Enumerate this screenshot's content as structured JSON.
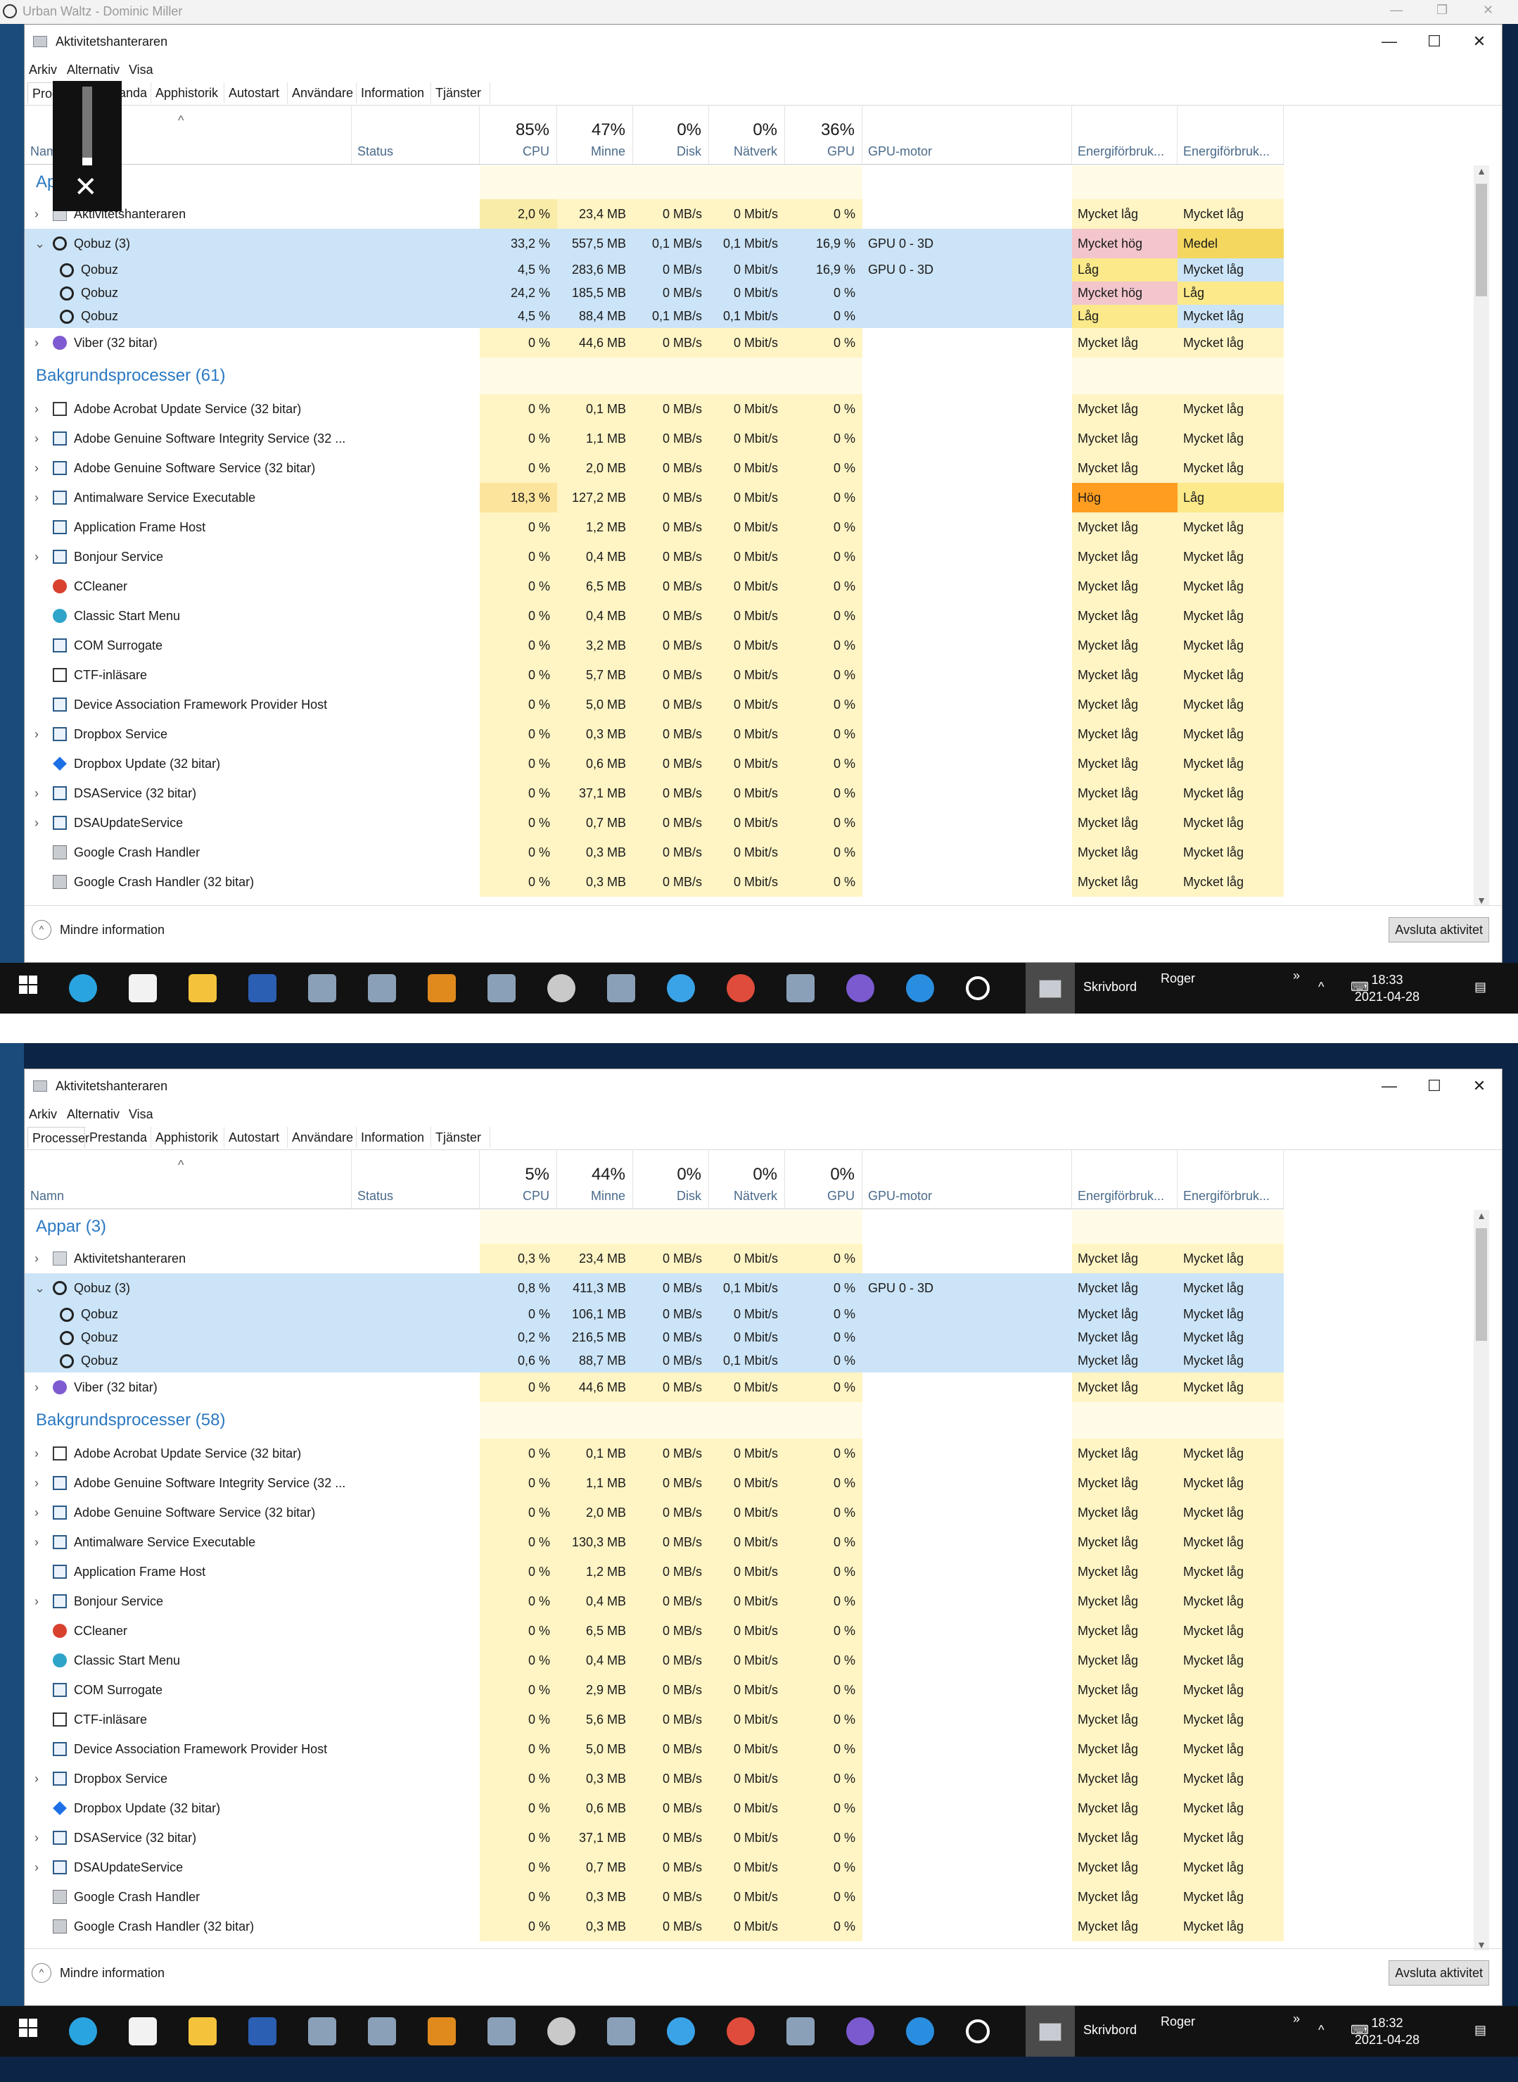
{
  "background_window": {
    "title": "Urban Waltz - Dominic Miller"
  },
  "taskbar": {
    "desktop_label": "Skrivbord",
    "user_label": "Roger",
    "overflow_label": "»",
    "caret_label": "^",
    "icons": [
      "windows-icon",
      "edge-icon",
      "store-icon",
      "explorer-icon",
      "word-icon",
      "app-icon",
      "app-icon",
      "outlook-icon",
      "app-icon",
      "esi-icon",
      "app-icon",
      "itunes-icon",
      "chrome-icon",
      "app-icon",
      "viber-icon",
      "ie-icon",
      "qobuz-icon",
      "taskmanager-icon"
    ]
  },
  "shots": [
    {
      "window_title": "Aktivitetshanteraren",
      "menu": [
        "Arkiv",
        "Alternativ",
        "Visa"
      ],
      "tabs": [
        "Processer",
        "Prestanda",
        "Apphistorik",
        "Autostart",
        "Användare",
        "Information",
        "Tjänster"
      ],
      "header": {
        "name": "Namn",
        "status": "Status",
        "cpu_pct": "85%",
        "cpu": "CPU",
        "mem_pct": "47%",
        "mem": "Minne",
        "disk_pct": "0%",
        "disk": "Disk",
        "net_pct": "0%",
        "net": "Nätverk",
        "gpu_pct": "36%",
        "gpu": "GPU",
        "gpu_engine": "GPU-motor",
        "energy": "Energiförbruk...",
        "energy_trend": "Energiförbruk..."
      },
      "groups": {
        "apps": "Appar (3)",
        "background": "Bakgrundsprocesser (61)"
      },
      "apps": [
        {
          "name": "Aktivitetshanteraren",
          "icon": "gear-icon",
          "chev": ">",
          "cpu": "2,0 %",
          "mem": "23,4 MB",
          "disk": "0 MB/s",
          "net": "0 Mbit/s",
          "gpu": "0 %",
          "engine": "",
          "energy": "Mycket låg",
          "trend": "Mycket låg"
        },
        {
          "name": "Qobuz (3)",
          "icon": "qobuz-icon",
          "chev": "v",
          "selected": true,
          "cpu": "33,2 %",
          "mem": "557,5 MB",
          "disk": "0,1 MB/s",
          "net": "0,1 Mbit/s",
          "gpu": "16,9 %",
          "engine": "GPU 0 - 3D",
          "energy": "Mycket hög",
          "trend": "Medel"
        },
        {
          "name": "Qobuz",
          "icon": "qobuz-icon",
          "child": true,
          "selected": true,
          "cpu": "4,5 %",
          "mem": "283,6 MB",
          "disk": "0 MB/s",
          "net": "0 Mbit/s",
          "gpu": "16,9 %",
          "engine": "GPU 0 - 3D",
          "energy": "Låg",
          "trend": "Mycket låg"
        },
        {
          "name": "Qobuz",
          "icon": "qobuz-icon",
          "child": true,
          "selected": true,
          "cpu": "24,2 %",
          "mem": "185,5 MB",
          "disk": "0 MB/s",
          "net": "0 Mbit/s",
          "gpu": "0 %",
          "engine": "",
          "energy": "Mycket hög",
          "trend": "Låg"
        },
        {
          "name": "Qobuz",
          "icon": "qobuz-icon",
          "child": true,
          "selected": true,
          "cpu": "4,5 %",
          "mem": "88,4 MB",
          "disk": "0,1 MB/s",
          "net": "0,1 Mbit/s",
          "gpu": "0 %",
          "engine": "",
          "energy": "Låg",
          "trend": "Mycket låg"
        },
        {
          "name": "Viber (32 bitar)",
          "icon": "viber-icon",
          "chev": ">",
          "cpu": "0 %",
          "mem": "44,6 MB",
          "disk": "0 MB/s",
          "net": "0 Mbit/s",
          "gpu": "0 %",
          "engine": "",
          "energy": "Mycket låg",
          "trend": "Mycket låg"
        }
      ],
      "background": [
        {
          "name": "Adobe Acrobat Update Service (32 bitar)",
          "icon": "acrobat-icon",
          "chev": ">",
          "cpu": "0 %",
          "mem": "0,1 MB",
          "disk": "0 MB/s",
          "net": "0 Mbit/s",
          "gpu": "0 %",
          "energy": "Mycket låg",
          "trend": "Mycket låg"
        },
        {
          "name": "Adobe Genuine Software Integrity Service (32 ...",
          "icon": "window-icon",
          "chev": ">",
          "cpu": "0 %",
          "mem": "1,1 MB",
          "disk": "0 MB/s",
          "net": "0 Mbit/s",
          "gpu": "0 %",
          "energy": "Mycket låg",
          "trend": "Mycket låg"
        },
        {
          "name": "Adobe Genuine Software Service (32 bitar)",
          "icon": "window-icon",
          "chev": ">",
          "cpu": "0 %",
          "mem": "2,0 MB",
          "disk": "0 MB/s",
          "net": "0 Mbit/s",
          "gpu": "0 %",
          "energy": "Mycket låg",
          "trend": "Mycket låg"
        },
        {
          "name": "Antimalware Service Executable",
          "icon": "window-icon",
          "chev": ">",
          "cpu": "18,3 %",
          "mem": "127,2 MB",
          "disk": "0 MB/s",
          "net": "0 Mbit/s",
          "gpu": "0 %",
          "energy": "Hög",
          "trend": "Låg"
        },
        {
          "name": "Application Frame Host",
          "icon": "window-icon",
          "cpu": "0 %",
          "mem": "1,2 MB",
          "disk": "0 MB/s",
          "net": "0 Mbit/s",
          "gpu": "0 %",
          "energy": "Mycket låg",
          "trend": "Mycket låg"
        },
        {
          "name": "Bonjour Service",
          "icon": "window-icon",
          "chev": ">",
          "cpu": "0 %",
          "mem": "0,4 MB",
          "disk": "0 MB/s",
          "net": "0 Mbit/s",
          "gpu": "0 %",
          "energy": "Mycket låg",
          "trend": "Mycket låg"
        },
        {
          "name": "CCleaner",
          "icon": "ccleaner-icon",
          "cpu": "0 %",
          "mem": "6,5 MB",
          "disk": "0 MB/s",
          "net": "0 Mbit/s",
          "gpu": "0 %",
          "energy": "Mycket låg",
          "trend": "Mycket låg"
        },
        {
          "name": "Classic Start Menu",
          "icon": "classic-start-icon",
          "cpu": "0 %",
          "mem": "0,4 MB",
          "disk": "0 MB/s",
          "net": "0 Mbit/s",
          "gpu": "0 %",
          "energy": "Mycket låg",
          "trend": "Mycket låg"
        },
        {
          "name": "COM Surrogate",
          "icon": "window-icon",
          "cpu": "0 %",
          "mem": "3,2 MB",
          "disk": "0 MB/s",
          "net": "0 Mbit/s",
          "gpu": "0 %",
          "energy": "Mycket låg",
          "trend": "Mycket låg"
        },
        {
          "name": "CTF-inläsare",
          "icon": "ctf-icon",
          "cpu": "0 %",
          "mem": "5,7 MB",
          "disk": "0 MB/s",
          "net": "0 Mbit/s",
          "gpu": "0 %",
          "energy": "Mycket låg",
          "trend": "Mycket låg"
        },
        {
          "name": "Device Association Framework Provider Host",
          "icon": "window-icon",
          "cpu": "0 %",
          "mem": "5,0 MB",
          "disk": "0 MB/s",
          "net": "0 Mbit/s",
          "gpu": "0 %",
          "energy": "Mycket låg",
          "trend": "Mycket låg"
        },
        {
          "name": "Dropbox Service",
          "icon": "window-icon",
          "chev": ">",
          "cpu": "0 %",
          "mem": "0,3 MB",
          "disk": "0 MB/s",
          "net": "0 Mbit/s",
          "gpu": "0 %",
          "energy": "Mycket låg",
          "trend": "Mycket låg"
        },
        {
          "name": "Dropbox Update (32 bitar)",
          "icon": "dropbox-icon",
          "cpu": "0 %",
          "mem": "0,6 MB",
          "disk": "0 MB/s",
          "net": "0 Mbit/s",
          "gpu": "0 %",
          "energy": "Mycket låg",
          "trend": "Mycket låg"
        },
        {
          "name": "DSAService (32 bitar)",
          "icon": "window-icon",
          "chev": ">",
          "cpu": "0 %",
          "mem": "37,1 MB",
          "disk": "0 MB/s",
          "net": "0 Mbit/s",
          "gpu": "0 %",
          "energy": "Mycket låg",
          "trend": "Mycket låg"
        },
        {
          "name": "DSAUpdateService",
          "icon": "window-icon",
          "chev": ">",
          "cpu": "0 %",
          "mem": "0,7 MB",
          "disk": "0 MB/s",
          "net": "0 Mbit/s",
          "gpu": "0 %",
          "energy": "Mycket låg",
          "trend": "Mycket låg"
        },
        {
          "name": "Google Crash Handler",
          "icon": "crash-handler-icon",
          "cpu": "0 %",
          "mem": "0,3 MB",
          "disk": "0 MB/s",
          "net": "0 Mbit/s",
          "gpu": "0 %",
          "energy": "Mycket låg",
          "trend": "Mycket låg"
        },
        {
          "name": "Google Crash Handler (32 bitar)",
          "icon": "crash-handler-icon",
          "cpu": "0 %",
          "mem": "0,3 MB",
          "disk": "0 MB/s",
          "net": "0 Mbit/s",
          "gpu": "0 %",
          "energy": "Mycket låg",
          "trend": "Mycket låg"
        }
      ],
      "footer": {
        "less_info": "Mindre information",
        "end_task": "Avsluta aktivitet"
      },
      "overlay_volume": 0.1,
      "clock": {
        "time": "18:33",
        "date": "2021-04-28"
      }
    },
    {
      "window_title": "Aktivitetshanteraren",
      "menu": [
        "Arkiv",
        "Alternativ",
        "Visa"
      ],
      "tabs": [
        "Processer",
        "Prestanda",
        "Apphistorik",
        "Autostart",
        "Användare",
        "Information",
        "Tjänster"
      ],
      "header": {
        "name": "Namn",
        "status": "Status",
        "cpu_pct": "5%",
        "cpu": "CPU",
        "mem_pct": "44%",
        "mem": "Minne",
        "disk_pct": "0%",
        "disk": "Disk",
        "net_pct": "0%",
        "net": "Nätverk",
        "gpu_pct": "0%",
        "gpu": "GPU",
        "gpu_engine": "GPU-motor",
        "energy": "Energiförbruk...",
        "energy_trend": "Energiförbruk..."
      },
      "groups": {
        "apps": "Appar (3)",
        "background": "Bakgrundsprocesser (58)"
      },
      "apps": [
        {
          "name": "Aktivitetshanteraren",
          "icon": "gear-icon",
          "chev": ">",
          "cpu": "0,3 %",
          "mem": "23,4 MB",
          "disk": "0 MB/s",
          "net": "0 Mbit/s",
          "gpu": "0 %",
          "engine": "",
          "energy": "Mycket låg",
          "trend": "Mycket låg"
        },
        {
          "name": "Qobuz (3)",
          "icon": "qobuz-icon",
          "chev": "v",
          "selected": true,
          "cpu": "0,8 %",
          "mem": "411,3 MB",
          "disk": "0 MB/s",
          "net": "0,1 Mbit/s",
          "gpu": "0 %",
          "engine": "GPU 0 - 3D",
          "energy": "Mycket låg",
          "trend": "Mycket låg"
        },
        {
          "name": "Qobuz",
          "icon": "qobuz-icon",
          "child": true,
          "selected": true,
          "cpu": "0 %",
          "mem": "106,1 MB",
          "disk": "0 MB/s",
          "net": "0 Mbit/s",
          "gpu": "0 %",
          "engine": "",
          "energy": "Mycket låg",
          "trend": "Mycket låg"
        },
        {
          "name": "Qobuz",
          "icon": "qobuz-icon",
          "child": true,
          "selected": true,
          "cpu": "0,2 %",
          "mem": "216,5 MB",
          "disk": "0 MB/s",
          "net": "0 Mbit/s",
          "gpu": "0 %",
          "engine": "",
          "energy": "Mycket låg",
          "trend": "Mycket låg"
        },
        {
          "name": "Qobuz",
          "icon": "qobuz-icon",
          "child": true,
          "selected": true,
          "cpu": "0,6 %",
          "mem": "88,7 MB",
          "disk": "0 MB/s",
          "net": "0,1 Mbit/s",
          "gpu": "0 %",
          "engine": "",
          "energy": "Mycket låg",
          "trend": "Mycket låg"
        },
        {
          "name": "Viber (32 bitar)",
          "icon": "viber-icon",
          "chev": ">",
          "cpu": "0 %",
          "mem": "44,6 MB",
          "disk": "0 MB/s",
          "net": "0 Mbit/s",
          "gpu": "0 %",
          "engine": "",
          "energy": "Mycket låg",
          "trend": "Mycket låg"
        }
      ],
      "background": [
        {
          "name": "Adobe Acrobat Update Service (32 bitar)",
          "icon": "acrobat-icon",
          "chev": ">",
          "cpu": "0 %",
          "mem": "0,1 MB",
          "disk": "0 MB/s",
          "net": "0 Mbit/s",
          "gpu": "0 %",
          "energy": "Mycket låg",
          "trend": "Mycket låg"
        },
        {
          "name": "Adobe Genuine Software Integrity Service (32 ...",
          "icon": "window-icon",
          "chev": ">",
          "cpu": "0 %",
          "mem": "1,1 MB",
          "disk": "0 MB/s",
          "net": "0 Mbit/s",
          "gpu": "0 %",
          "energy": "Mycket låg",
          "trend": "Mycket låg"
        },
        {
          "name": "Adobe Genuine Software Service (32 bitar)",
          "icon": "window-icon",
          "chev": ">",
          "cpu": "0 %",
          "mem": "2,0 MB",
          "disk": "0 MB/s",
          "net": "0 Mbit/s",
          "gpu": "0 %",
          "energy": "Mycket låg",
          "trend": "Mycket låg"
        },
        {
          "name": "Antimalware Service Executable",
          "icon": "window-icon",
          "chev": ">",
          "cpu": "0 %",
          "mem": "130,3 MB",
          "disk": "0 MB/s",
          "net": "0 Mbit/s",
          "gpu": "0 %",
          "energy": "Mycket låg",
          "trend": "Mycket låg"
        },
        {
          "name": "Application Frame Host",
          "icon": "window-icon",
          "cpu": "0 %",
          "mem": "1,2 MB",
          "disk": "0 MB/s",
          "net": "0 Mbit/s",
          "gpu": "0 %",
          "energy": "Mycket låg",
          "trend": "Mycket låg"
        },
        {
          "name": "Bonjour Service",
          "icon": "window-icon",
          "chev": ">",
          "cpu": "0 %",
          "mem": "0,4 MB",
          "disk": "0 MB/s",
          "net": "0 Mbit/s",
          "gpu": "0 %",
          "energy": "Mycket låg",
          "trend": "Mycket låg"
        },
        {
          "name": "CCleaner",
          "icon": "ccleaner-icon",
          "cpu": "0 %",
          "mem": "6,5 MB",
          "disk": "0 MB/s",
          "net": "0 Mbit/s",
          "gpu": "0 %",
          "energy": "Mycket låg",
          "trend": "Mycket låg"
        },
        {
          "name": "Classic Start Menu",
          "icon": "classic-start-icon",
          "cpu": "0 %",
          "mem": "0,4 MB",
          "disk": "0 MB/s",
          "net": "0 Mbit/s",
          "gpu": "0 %",
          "energy": "Mycket låg",
          "trend": "Mycket låg"
        },
        {
          "name": "COM Surrogate",
          "icon": "window-icon",
          "cpu": "0 %",
          "mem": "2,9 MB",
          "disk": "0 MB/s",
          "net": "0 Mbit/s",
          "gpu": "0 %",
          "energy": "Mycket låg",
          "trend": "Mycket låg"
        },
        {
          "name": "CTF-inläsare",
          "icon": "ctf-icon",
          "cpu": "0 %",
          "mem": "5,6 MB",
          "disk": "0 MB/s",
          "net": "0 Mbit/s",
          "gpu": "0 %",
          "energy": "Mycket låg",
          "trend": "Mycket låg"
        },
        {
          "name": "Device Association Framework Provider Host",
          "icon": "window-icon",
          "cpu": "0 %",
          "mem": "5,0 MB",
          "disk": "0 MB/s",
          "net": "0 Mbit/s",
          "gpu": "0 %",
          "energy": "Mycket låg",
          "trend": "Mycket låg"
        },
        {
          "name": "Dropbox Service",
          "icon": "window-icon",
          "chev": ">",
          "cpu": "0 %",
          "mem": "0,3 MB",
          "disk": "0 MB/s",
          "net": "0 Mbit/s",
          "gpu": "0 %",
          "energy": "Mycket låg",
          "trend": "Mycket låg"
        },
        {
          "name": "Dropbox Update (32 bitar)",
          "icon": "dropbox-icon",
          "cpu": "0 %",
          "mem": "0,6 MB",
          "disk": "0 MB/s",
          "net": "0 Mbit/s",
          "gpu": "0 %",
          "energy": "Mycket låg",
          "trend": "Mycket låg"
        },
        {
          "name": "DSAService (32 bitar)",
          "icon": "window-icon",
          "chev": ">",
          "cpu": "0 %",
          "mem": "37,1 MB",
          "disk": "0 MB/s",
          "net": "0 Mbit/s",
          "gpu": "0 %",
          "energy": "Mycket låg",
          "trend": "Mycket låg"
        },
        {
          "name": "DSAUpdateService",
          "icon": "window-icon",
          "chev": ">",
          "cpu": "0 %",
          "mem": "0,7 MB",
          "disk": "0 MB/s",
          "net": "0 Mbit/s",
          "gpu": "0 %",
          "energy": "Mycket låg",
          "trend": "Mycket låg"
        },
        {
          "name": "Google Crash Handler",
          "icon": "crash-handler-icon",
          "cpu": "0 %",
          "mem": "0,3 MB",
          "disk": "0 MB/s",
          "net": "0 Mbit/s",
          "gpu": "0 %",
          "energy": "Mycket låg",
          "trend": "Mycket låg"
        },
        {
          "name": "Google Crash Handler (32 bitar)",
          "icon": "crash-handler-icon",
          "cpu": "0 %",
          "mem": "0,3 MB",
          "disk": "0 MB/s",
          "net": "0 Mbit/s",
          "gpu": "0 %",
          "energy": "Mycket låg",
          "trend": "Mycket låg"
        }
      ],
      "footer": {
        "less_info": "Mindre information",
        "end_task": "Avsluta aktivitet"
      },
      "clock": {
        "time": "18:32",
        "date": "2021-04-28"
      }
    }
  ]
}
